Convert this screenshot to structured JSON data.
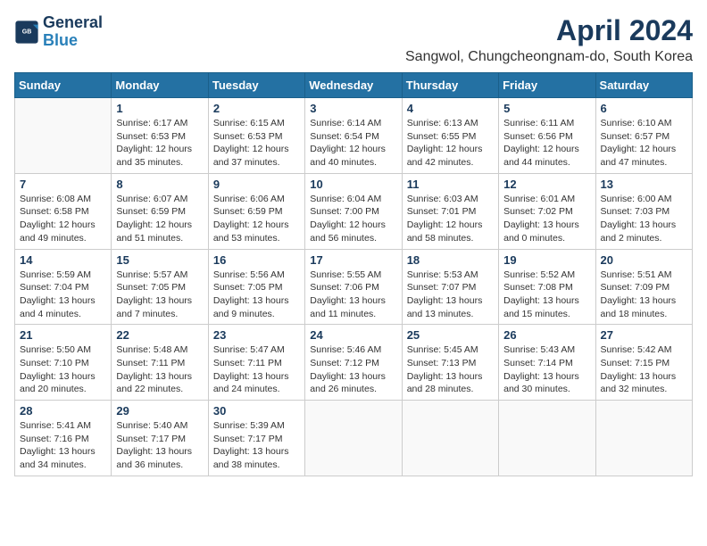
{
  "header": {
    "logo_line1": "General",
    "logo_line2": "Blue",
    "title": "April 2024",
    "subtitle": "Sangwol, Chungcheongnam-do, South Korea"
  },
  "weekdays": [
    "Sunday",
    "Monday",
    "Tuesday",
    "Wednesday",
    "Thursday",
    "Friday",
    "Saturday"
  ],
  "weeks": [
    [
      {
        "day": "",
        "info": ""
      },
      {
        "day": "1",
        "info": "Sunrise: 6:17 AM\nSunset: 6:53 PM\nDaylight: 12 hours\nand 35 minutes."
      },
      {
        "day": "2",
        "info": "Sunrise: 6:15 AM\nSunset: 6:53 PM\nDaylight: 12 hours\nand 37 minutes."
      },
      {
        "day": "3",
        "info": "Sunrise: 6:14 AM\nSunset: 6:54 PM\nDaylight: 12 hours\nand 40 minutes."
      },
      {
        "day": "4",
        "info": "Sunrise: 6:13 AM\nSunset: 6:55 PM\nDaylight: 12 hours\nand 42 minutes."
      },
      {
        "day": "5",
        "info": "Sunrise: 6:11 AM\nSunset: 6:56 PM\nDaylight: 12 hours\nand 44 minutes."
      },
      {
        "day": "6",
        "info": "Sunrise: 6:10 AM\nSunset: 6:57 PM\nDaylight: 12 hours\nand 47 minutes."
      }
    ],
    [
      {
        "day": "7",
        "info": "Sunrise: 6:08 AM\nSunset: 6:58 PM\nDaylight: 12 hours\nand 49 minutes."
      },
      {
        "day": "8",
        "info": "Sunrise: 6:07 AM\nSunset: 6:59 PM\nDaylight: 12 hours\nand 51 minutes."
      },
      {
        "day": "9",
        "info": "Sunrise: 6:06 AM\nSunset: 6:59 PM\nDaylight: 12 hours\nand 53 minutes."
      },
      {
        "day": "10",
        "info": "Sunrise: 6:04 AM\nSunset: 7:00 PM\nDaylight: 12 hours\nand 56 minutes."
      },
      {
        "day": "11",
        "info": "Sunrise: 6:03 AM\nSunset: 7:01 PM\nDaylight: 12 hours\nand 58 minutes."
      },
      {
        "day": "12",
        "info": "Sunrise: 6:01 AM\nSunset: 7:02 PM\nDaylight: 13 hours\nand 0 minutes."
      },
      {
        "day": "13",
        "info": "Sunrise: 6:00 AM\nSunset: 7:03 PM\nDaylight: 13 hours\nand 2 minutes."
      }
    ],
    [
      {
        "day": "14",
        "info": "Sunrise: 5:59 AM\nSunset: 7:04 PM\nDaylight: 13 hours\nand 4 minutes."
      },
      {
        "day": "15",
        "info": "Sunrise: 5:57 AM\nSunset: 7:05 PM\nDaylight: 13 hours\nand 7 minutes."
      },
      {
        "day": "16",
        "info": "Sunrise: 5:56 AM\nSunset: 7:05 PM\nDaylight: 13 hours\nand 9 minutes."
      },
      {
        "day": "17",
        "info": "Sunrise: 5:55 AM\nSunset: 7:06 PM\nDaylight: 13 hours\nand 11 minutes."
      },
      {
        "day": "18",
        "info": "Sunrise: 5:53 AM\nSunset: 7:07 PM\nDaylight: 13 hours\nand 13 minutes."
      },
      {
        "day": "19",
        "info": "Sunrise: 5:52 AM\nSunset: 7:08 PM\nDaylight: 13 hours\nand 15 minutes."
      },
      {
        "day": "20",
        "info": "Sunrise: 5:51 AM\nSunset: 7:09 PM\nDaylight: 13 hours\nand 18 minutes."
      }
    ],
    [
      {
        "day": "21",
        "info": "Sunrise: 5:50 AM\nSunset: 7:10 PM\nDaylight: 13 hours\nand 20 minutes."
      },
      {
        "day": "22",
        "info": "Sunrise: 5:48 AM\nSunset: 7:11 PM\nDaylight: 13 hours\nand 22 minutes."
      },
      {
        "day": "23",
        "info": "Sunrise: 5:47 AM\nSunset: 7:11 PM\nDaylight: 13 hours\nand 24 minutes."
      },
      {
        "day": "24",
        "info": "Sunrise: 5:46 AM\nSunset: 7:12 PM\nDaylight: 13 hours\nand 26 minutes."
      },
      {
        "day": "25",
        "info": "Sunrise: 5:45 AM\nSunset: 7:13 PM\nDaylight: 13 hours\nand 28 minutes."
      },
      {
        "day": "26",
        "info": "Sunrise: 5:43 AM\nSunset: 7:14 PM\nDaylight: 13 hours\nand 30 minutes."
      },
      {
        "day": "27",
        "info": "Sunrise: 5:42 AM\nSunset: 7:15 PM\nDaylight: 13 hours\nand 32 minutes."
      }
    ],
    [
      {
        "day": "28",
        "info": "Sunrise: 5:41 AM\nSunset: 7:16 PM\nDaylight: 13 hours\nand 34 minutes."
      },
      {
        "day": "29",
        "info": "Sunrise: 5:40 AM\nSunset: 7:17 PM\nDaylight: 13 hours\nand 36 minutes."
      },
      {
        "day": "30",
        "info": "Sunrise: 5:39 AM\nSunset: 7:17 PM\nDaylight: 13 hours\nand 38 minutes."
      },
      {
        "day": "",
        "info": ""
      },
      {
        "day": "",
        "info": ""
      },
      {
        "day": "",
        "info": ""
      },
      {
        "day": "",
        "info": ""
      }
    ]
  ]
}
